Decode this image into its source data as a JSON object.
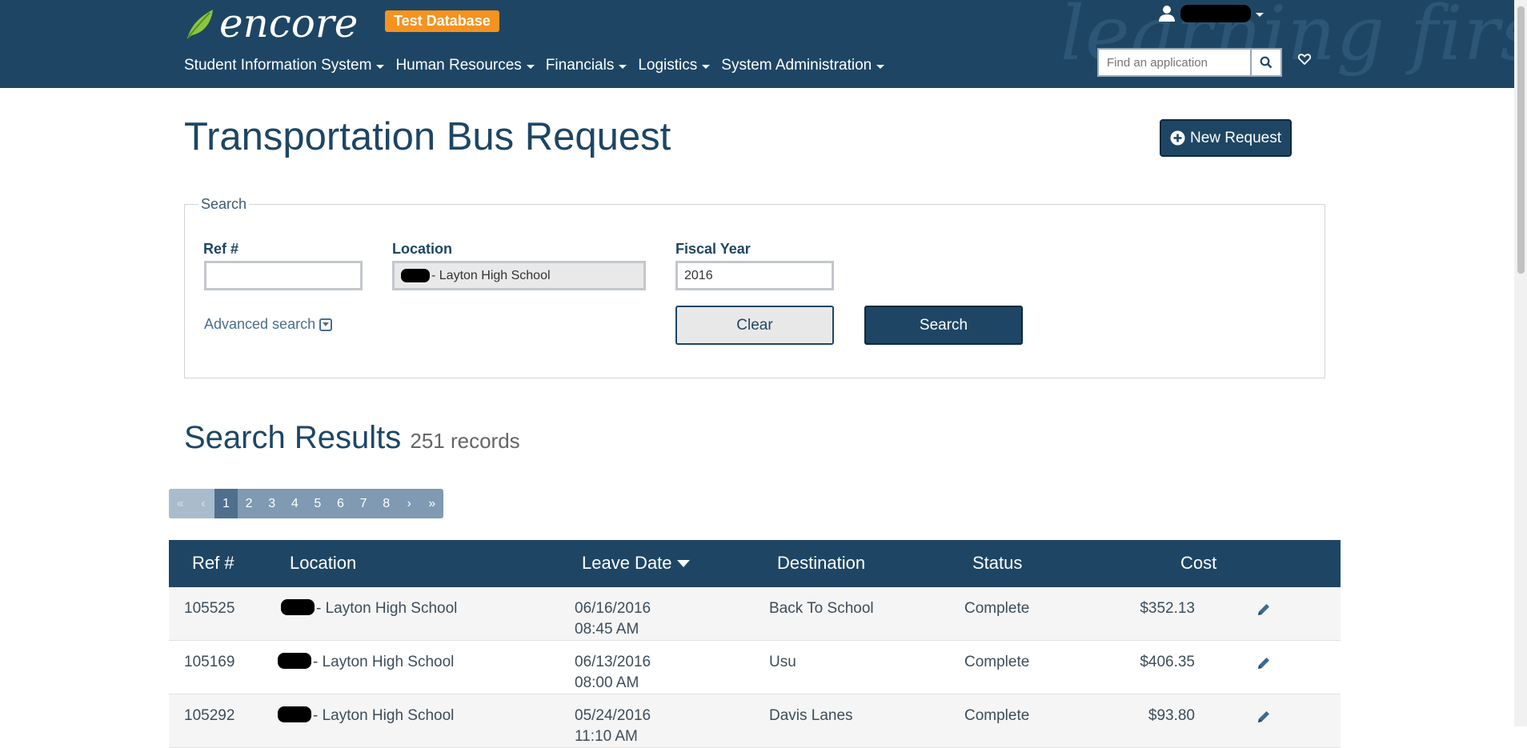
{
  "header": {
    "logo_text": "encore",
    "badge": "Test Database",
    "watermark": "learning first",
    "nav": [
      {
        "label": "Student Information System"
      },
      {
        "label": "Human Resources"
      },
      {
        "label": "Financials"
      },
      {
        "label": "Logistics"
      },
      {
        "label": "System Administration"
      }
    ],
    "app_search_placeholder": "Find an application"
  },
  "page": {
    "title": "Transportation Bus Request",
    "new_request_label": "New Request"
  },
  "search": {
    "legend": "Search",
    "ref_label": "Ref #",
    "ref_value": "",
    "location_label": "Location",
    "location_value": "- Layton High School",
    "fiscal_year_label": "Fiscal Year",
    "fiscal_year_value": "2016",
    "advanced_label": "Advanced search",
    "clear_label": "Clear",
    "search_label": "Search"
  },
  "results": {
    "title": "Search Results",
    "count": "251 records"
  },
  "pagination": {
    "first": "«",
    "prev": "‹",
    "pages": [
      "1",
      "2",
      "3",
      "4",
      "5",
      "6",
      "7",
      "8"
    ],
    "next": "›",
    "last": "»",
    "current": "1"
  },
  "table": {
    "headers": {
      "ref": "Ref #",
      "location": "Location",
      "leave_date": "Leave Date",
      "destination": "Destination",
      "status": "Status",
      "cost": "Cost"
    },
    "rows": [
      {
        "ref": "105525",
        "location": "- Layton High School",
        "date": "06/16/2016",
        "time": "08:45 AM",
        "destination": "Back To School",
        "status": "Complete",
        "cost": "$352.13"
      },
      {
        "ref": "105169",
        "location": "- Layton High School",
        "date": "06/13/2016",
        "time": "08:00 AM",
        "destination": "Usu",
        "status": "Complete",
        "cost": "$406.35"
      },
      {
        "ref": "105292",
        "location": "- Layton High School",
        "date": "05/24/2016",
        "time": "11:10 AM",
        "destination": "Davis Lanes",
        "status": "Complete",
        "cost": "$93.80"
      }
    ]
  },
  "colors": {
    "primary": "#1e4664",
    "badge": "#f6921e",
    "logo_leaf": "#8cc63f"
  }
}
